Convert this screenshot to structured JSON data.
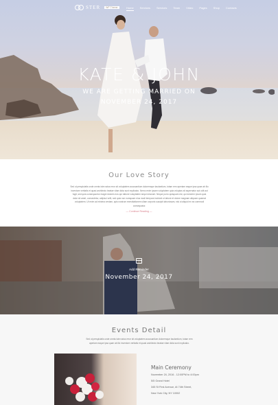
{
  "nav": {
    "logo_left": "O",
    "logo_right": "STER",
    "logo_badge": "WP Theme",
    "items": [
      "Home",
      "Services",
      "Services",
      "Team",
      "Video",
      "Pages",
      "Shop",
      "Contacts"
    ]
  },
  "hero": {
    "title": "KATE & JOHN",
    "subtitle": "WE ARE GETTING MARRIED ON",
    "date": "NOVEMBER 24, 2017"
  },
  "story": {
    "title": "Our Love Story",
    "text": "Sed ut perspiciatis unde omnis iste natus error sit voluptatem accusantium doloremque laudantium, totam rem aperiam eaque ipsa quae ab illo inventore veritatis et quasi architecto beatae vitae dicta sunt explicabo. Nemo enim ipsam voluptatem quia voluptas sit aspernatur aut odit aut fugit, sed quia consequuntur magni dolores eos qui ratione voluptatem sequi nesciunt. Neque porro quisquam est, qui dolorem ipsum quia dolor sit amet, consectetur, adipisci velit, sed quia non numquam eius modi tempora incidunt ut labore et dolore magnam aliquam quaerat voluptatem. Ut enim ad minima veniam, quis nostrum exercitationem ullam corporis suscipit laboriosam, nisi ut aliquid ex ea commodi consequatur.",
    "more": "— Continue Reading —"
  },
  "date_section": {
    "add_label": "Add Reminder",
    "date": "November 24, 2017"
  },
  "events": {
    "title": "Events Detail",
    "text": "Sed ut perspiciatis unde omnis iste natus error sit voluptatem accusantium doloremque laudantium, totam rem aperiam eaque ipsa quae ab illo inventore veritatis et quasi architecto beatae vitae dicta sunt explicabo.",
    "event_title": "Main Ceremony",
    "event_time": "November 24, 2016 - 12:00PM to 4:00pm",
    "event_venue": "5/5 Grand Hotel",
    "event_address": "345 St First Avenue, At 74th Street,",
    "event_city": "New York City, NY 10002"
  },
  "colors": {
    "accent": "#d9818e",
    "heading": "#8b8b8b"
  }
}
